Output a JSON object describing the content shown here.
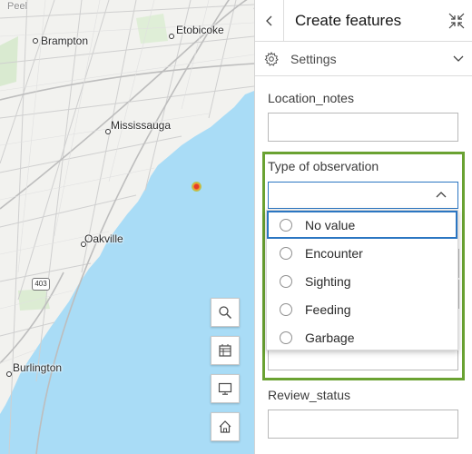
{
  "map": {
    "labels": {
      "peel": "Peel",
      "brampton": "Brampton",
      "etobicoke": "Etobicoke",
      "mississauga": "Mississauga",
      "oakville": "Oakville",
      "burlington": "Burlington",
      "highway": "403"
    },
    "tools": [
      "search-icon",
      "table-icon",
      "screen-icon",
      "home-icon"
    ]
  },
  "panel": {
    "title": "Create features",
    "settings_label": "Settings",
    "fields": {
      "location_notes": "Location_notes",
      "type_of_observation": "Type of observation",
      "review_status": "Review_status"
    },
    "dropdown_options": [
      "No value",
      "Encounter",
      "Sighting",
      "Feeding",
      "Garbage"
    ],
    "colors": {
      "accent": "#2b76c2",
      "highlight": "#6aa232",
      "water": "#a9dcf6"
    }
  }
}
